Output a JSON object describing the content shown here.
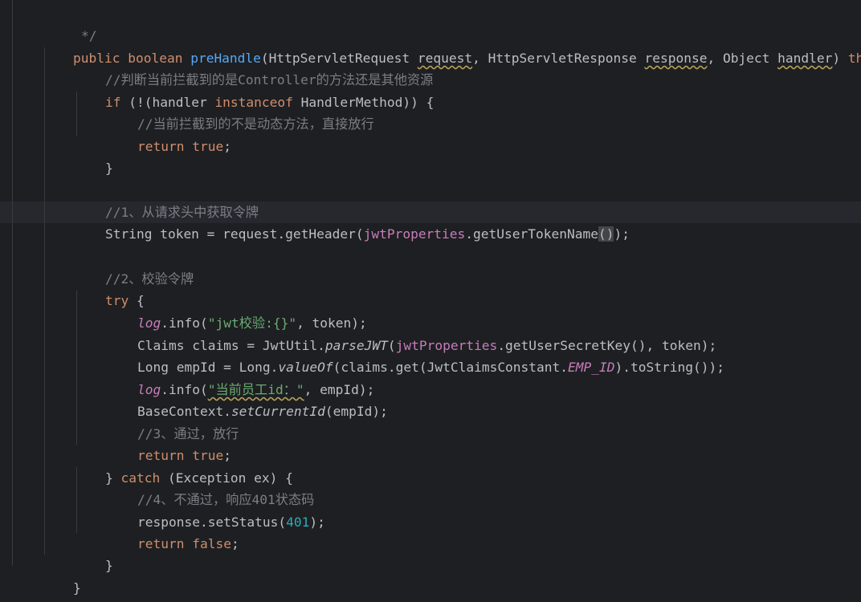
{
  "lines": {
    "l0": "*/",
    "l1": {
      "kw1": "public",
      "kw2": "boolean",
      "fn": "preHandle",
      "t1": "(HttpServletRequest ",
      "p1": "request",
      "t2": ", HttpServletResponse ",
      "p2": "response",
      "t3": ", Object ",
      "p3": "handler",
      "t4": ") ",
      "kw3": "thr"
    },
    "l2": "//判断当前拦截到的是Controller的方法还是其他资源",
    "l3": {
      "kw1": "if",
      "t1": " (!(handler ",
      "kw2": "instanceof",
      "t2": " HandlerMethod)) {"
    },
    "l4": "//当前拦截到的不是动态方法，直接放行",
    "l5": {
      "kw": "return",
      "val": "true",
      "end": ";"
    },
    "l6": "}",
    "l7": "//1、从请求头中获取令牌",
    "l8": {
      "t1": "String token = request.getHeader(",
      "fld": "jwtProperties",
      "t2": ".getUserTokenName",
      "hl": "()",
      "t3": ");"
    },
    "l9": "//2、校验令牌",
    "l10": {
      "kw": "try",
      "t": " {"
    },
    "l11": {
      "log": "log",
      "t1": ".info(",
      "str": "\"jwt校验:{}\"",
      "t2": ", token);"
    },
    "l12": {
      "t1": "Claims claims = JwtUtil.",
      "m": "parseJWT",
      "t2": "(",
      "fld": "jwtProperties",
      "t3": ".getUserSecretKey(), token);"
    },
    "l13": {
      "t1": "Long empId = Long.",
      "m": "valueOf",
      "t2": "(claims.get(JwtClaimsConstant.",
      "c": "EMP_ID",
      "t3": ").toString());"
    },
    "l14": {
      "log": "log",
      "t1": ".info(",
      "str": "\"当前员工id：\"",
      "t2": ", empId);"
    },
    "l15": {
      "t1": "BaseContext.",
      "m": "setCurrentId",
      "t2": "(empId);"
    },
    "l16": "//3、通过，放行",
    "l17": {
      "kw": "return",
      "val": "true",
      "end": ";"
    },
    "l18": {
      "t1": "} ",
      "kw": "catch",
      "t2": " (Exception ex) {"
    },
    "l19": "//4、不通过，响应401状态码",
    "l20": {
      "t1": "response.setStatus(",
      "num": "401",
      "t2": ");"
    },
    "l21": {
      "kw": "return",
      "val": "false",
      "end": ";"
    },
    "l22": "}",
    "l23": "}",
    "l24": "}"
  }
}
